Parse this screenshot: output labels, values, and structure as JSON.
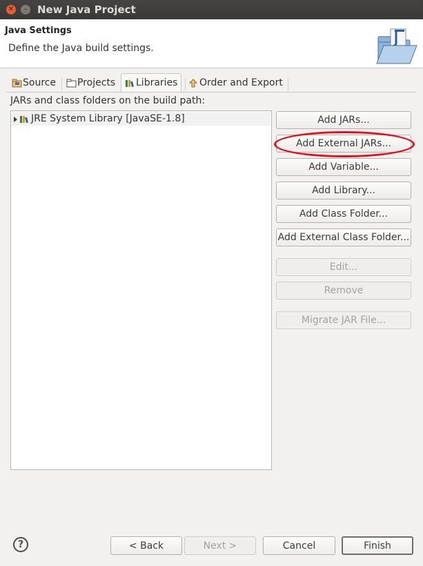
{
  "window": {
    "title": "New Java Project"
  },
  "header": {
    "title": "Java Settings",
    "subtitle": "Define the Java build settings."
  },
  "tabs": [
    {
      "label": "Source",
      "icon": "source-folder-icon"
    },
    {
      "label": "Projects",
      "icon": "projects-folder-icon"
    },
    {
      "label": "Libraries",
      "icon": "libraries-icon",
      "selected": true
    },
    {
      "label": "Order and Export",
      "icon": "order-export-icon"
    }
  ],
  "build_path_label": "JARs and class folders on the build path:",
  "tree": {
    "items": [
      {
        "label": "JRE System Library [JavaSE-1.8]",
        "icon": "library-jar-icon",
        "expanded": false
      }
    ]
  },
  "buttons": {
    "add_jars": "Add JARs...",
    "add_external_jars": "Add External JARs...",
    "add_variable": "Add Variable...",
    "add_library": "Add Library...",
    "add_class_folder": "Add Class Folder...",
    "add_external_class_folder": "Add External Class Folder...",
    "edit": "Edit...",
    "remove": "Remove",
    "migrate_jar": "Migrate JAR File..."
  },
  "footer": {
    "help": "?",
    "back": "< Back",
    "next": "Next >",
    "cancel": "Cancel",
    "finish": "Finish"
  },
  "colors": {
    "highlight_ellipse": "#e3101e",
    "titlebar": "#3e3d3b",
    "close_button": "#e95c31"
  }
}
